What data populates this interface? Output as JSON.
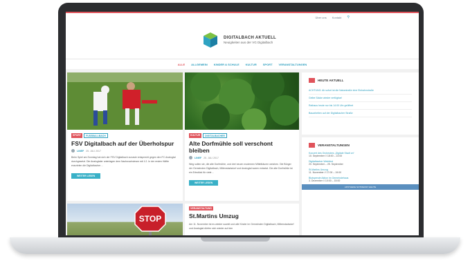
{
  "toplinks": {
    "about": "Über uns",
    "contact": "Kontakt"
  },
  "brand": {
    "title": "DIGITALBACH AKTUELL",
    "subtitle": "Neuigkeiten aus der VG Digitalbach"
  },
  "nav": [
    "ALLE",
    "ALLGEMEIN",
    "KINDER & SCHULE",
    "KULTUR",
    "SPORT",
    "VERANSTALTUNGEN"
  ],
  "articles": [
    {
      "tags": [
        "SPORT",
        "FUSSBALLBACH"
      ],
      "title": "FSV Digitalbach auf der Überholspur",
      "author": "LINEF",
      "date": "25. JULI 2017",
      "excerpt": "Beim Spiel am Sonntag hat sich der FSV Digitalbach zunasie entsprecht gegen den FC Analogtal durchgesetzt. Die Analogtaler unterlagen dem Nachwuchsteam mit 1:2. In der ersten Hälfte erarzielen die Digitalbacher…",
      "button": "WEITER LESEN"
    },
    {
      "tags": [
        "KULTUR",
        "DIGITALBACHER"
      ],
      "title": "Alte Dorfmühle soll verschont bleiben",
      "author": "LINEF",
      "date": "25. JULI 2017",
      "excerpt": "Weg sollen sie, die alte Dorfmühle, und drei neuen modernen Mittelbäuren weichen. Die Bürger der Gemeinden Digitalbach, Mittenstadsdorf und Analogtal waren entsetzt. Die alte Dorfmühle ist ein Erbstück für viele…",
      "button": "WEITER LESEN"
    },
    {
      "tags": [
        "VERANSTALTUNG"
      ],
      "title": "St.Martins Umzug",
      "excerpt": "Am 11. November ist es wieder soweit und alle Kinder im Gemeinden Digitalbach, Mittenstadsdorf und Analogtal dürfen sich wieder auf den"
    }
  ],
  "stop_sign_text": "STOP",
  "heute": {
    "title": "HEUTE AKTUELL",
    "items": [
      "ACHTUNG: Ab sofort ist die Naturstraße eine Einbahnstraße",
      "Gelbe Säcke wieder verfügbar!",
      "Rathaus heute nur bis 14:00 Uhr geöffnet",
      "Bauarbeiten auf der Digitalbacher Straße"
    ]
  },
  "events": {
    "title": "VERANSTALTUNGEN",
    "items": [
      {
        "name": "Konzert des Orchesters „Digitale Stadt on“",
        "date": "10. September // 18:00 – 22:00"
      },
      {
        "name": "Digitalbacher Weinfest",
        "date": "20. September – 25. September"
      },
      {
        "name": "St.Martins Umzug",
        "date": "11. November // 17:00 – 19:00"
      },
      {
        "name": "Blutspende Aktion im Gemeindehaus",
        "date": "3. Dezember // 10:00 – 15:00"
      }
    ],
    "more": "Alle Veranstaltungen anzeigen"
  },
  "banner": "APOTHEKE NOTDIENST HEUTE",
  "colors": {
    "accent_red": "#e0535b",
    "accent_blue": "#2a9dbe",
    "button": "#39b0c7"
  }
}
